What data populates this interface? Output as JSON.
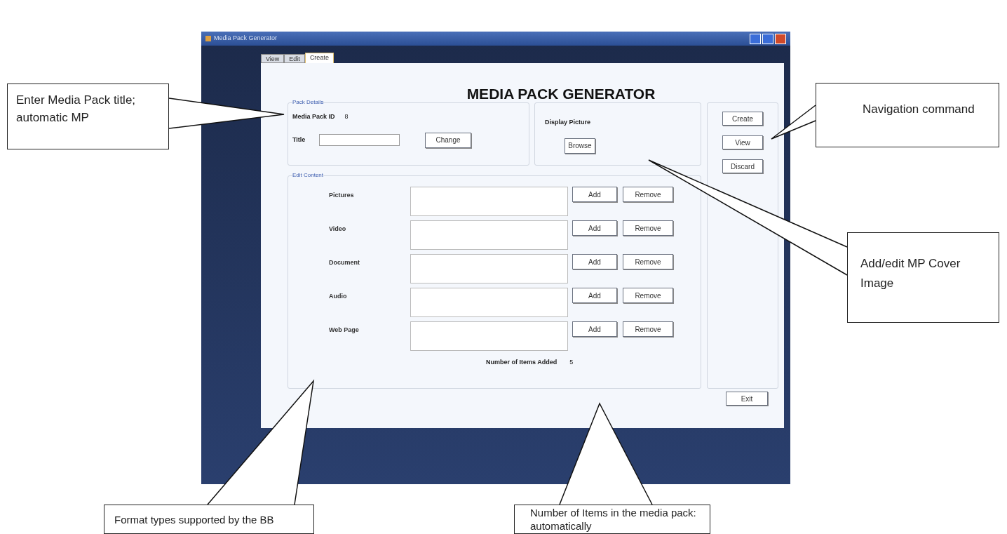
{
  "window": {
    "title": "Media Pack Generator"
  },
  "tabs": [
    {
      "label": "View",
      "selected": false
    },
    {
      "label": "Edit",
      "selected": false
    },
    {
      "label": "Create",
      "selected": true
    }
  ],
  "heading": "MEDIA PACK GENERATOR",
  "pack_details": {
    "legend": "Pack Details",
    "id_label": "Media Pack  ID",
    "id_value": "8",
    "title_label": "Title",
    "change_button": "Change"
  },
  "display_picture": {
    "label": "Display Picture",
    "browse_button": "Browse"
  },
  "content": {
    "legend": "Edit Content",
    "rows": [
      {
        "label": "Pictures",
        "add": "Add",
        "remove": "Remove"
      },
      {
        "label": "Video",
        "add": "Add",
        "remove": "Remove"
      },
      {
        "label": "Document",
        "add": "Add",
        "remove": "Remove"
      },
      {
        "label": "Audio",
        "add": "Add",
        "remove": "Remove"
      },
      {
        "label": "Web Page",
        "add": "Add",
        "remove": "Remove"
      }
    ],
    "count_label": "Number of Items Added",
    "count_value": "5"
  },
  "navigation": [
    "Create",
    "View",
    "Discard"
  ],
  "exit_button": "Exit",
  "callouts": [
    {
      "text": "Enter Media Pack title; automatic MP"
    },
    {
      "text": "Navigation command"
    },
    {
      "text": "Add/edit MP Cover Image"
    },
    {
      "text": "Format types supported by the BB"
    },
    {
      "text": "Number of Items in the media pack: automatically"
    }
  ]
}
